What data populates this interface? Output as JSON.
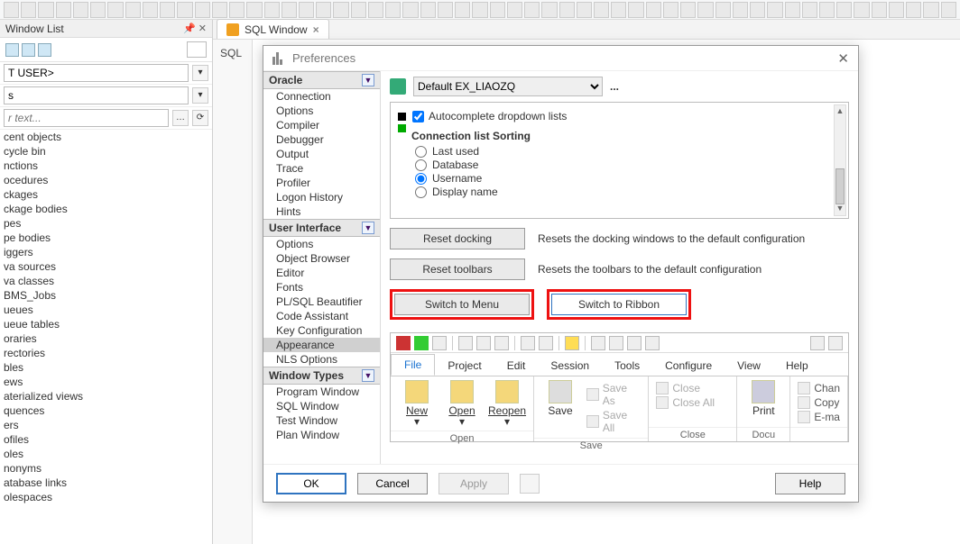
{
  "toolbar_icon_count": 55,
  "window_list": {
    "title": "Window List",
    "pin_glyph": "📌 ✕",
    "user_field": "T USER>",
    "kind_field": "s",
    "filter_placeholder": "r text...",
    "items": [
      "cent objects",
      "cycle bin",
      "nctions",
      "ocedures",
      "ckages",
      "ckage bodies",
      "pes",
      "pe bodies",
      "iggers",
      "va sources",
      "va classes",
      "BMS_Jobs",
      "ueues",
      "ueue tables",
      "oraries",
      "rectories",
      "bles",
      "ews",
      "aterialized views",
      "quences",
      "ers",
      "ofiles",
      "oles",
      "nonyms",
      "atabase links",
      "olespaces"
    ]
  },
  "tabs": {
    "sql_window": "SQL Window"
  },
  "gutter_label": "SQL",
  "dialog": {
    "title": "Preferences",
    "categories": {
      "oracle": {
        "label": "Oracle",
        "items": [
          "Connection",
          "Options",
          "Compiler",
          "Debugger",
          "Output",
          "Trace",
          "Profiler",
          "Logon History",
          "Hints"
        ]
      },
      "ui": {
        "label": "User Interface",
        "items": [
          "Options",
          "Object Browser",
          "Editor",
          "Fonts",
          "PL/SQL Beautifier",
          "Code Assistant",
          "Key Configuration",
          "Appearance",
          "NLS Options"
        ],
        "selected": "Appearance"
      },
      "wt": {
        "label": "Window Types",
        "items": [
          "Program Window",
          "SQL Window",
          "Test Window",
          "Plan Window"
        ]
      }
    },
    "profile": {
      "default": "Default EX_LIAOZQ",
      "dots": "..."
    },
    "settings": {
      "autocomplete": "Autocomplete dropdown lists",
      "conn_sort": "Connection list Sorting",
      "sort_opts": [
        "Last used",
        "Database",
        "Username",
        "Display name"
      ],
      "sort_selected": "Username"
    },
    "actions": {
      "reset_docking": "Reset docking",
      "reset_docking_desc": "Resets the docking windows to the default configuration",
      "reset_toolbars": "Reset toolbars",
      "reset_toolbars_desc": "Resets the toolbars to the default configuration",
      "switch_menu": "Switch to Menu",
      "switch_ribbon": "Switch to Ribbon"
    },
    "ribbon": {
      "tabs": [
        "File",
        "Project",
        "Edit",
        "Session",
        "Tools",
        "Configure",
        "View",
        "Help"
      ],
      "active_tab": "File",
      "group_open": {
        "cap": "Open",
        "new": "New",
        "open": "Open",
        "reopen": "Reopen"
      },
      "group_save": {
        "cap": "Save",
        "save": "Save",
        "save_as": "Save As",
        "save_all": "Save All"
      },
      "group_close": {
        "cap": "Close",
        "close": "Close",
        "close_all": "Close All"
      },
      "group_print": {
        "cap": "Docu",
        "print": "Print"
      },
      "side_items": [
        "Chan",
        "Copy",
        "E-ma"
      ]
    },
    "buttons": {
      "ok": "OK",
      "cancel": "Cancel",
      "apply": "Apply",
      "help": "Help"
    }
  }
}
